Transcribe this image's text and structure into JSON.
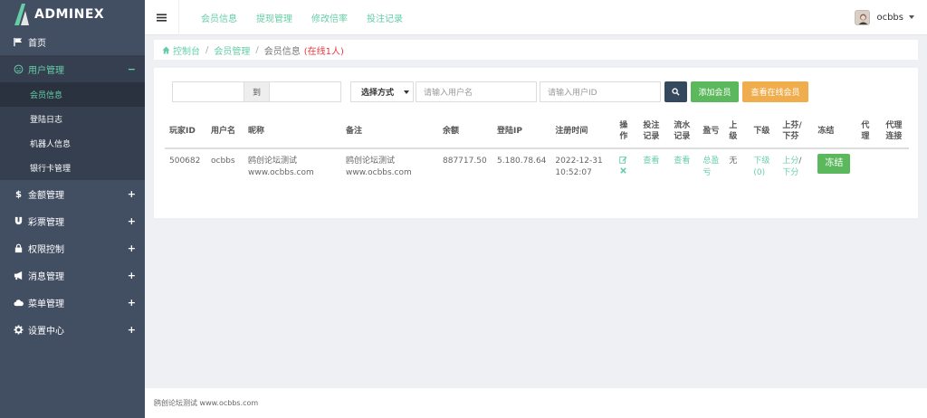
{
  "app": {
    "logo_text": "ADMINEX"
  },
  "colors": {
    "sidebar": "#424f63",
    "accent": "#65cea7",
    "success": "#5cb85c",
    "warning": "#f0ad4e",
    "primary_dark": "#34495e",
    "danger": "#e5383b"
  },
  "sidebar": {
    "items": [
      {
        "label": "首页",
        "icon": "flag-icon",
        "toggle": ""
      },
      {
        "label": "用户管理",
        "icon": "smile-icon",
        "toggle": "−",
        "active": true,
        "children": [
          "会员信息",
          "登陆日志",
          "机器人信息",
          "银行卡管理"
        ]
      },
      {
        "label": "金额管理",
        "icon": "dollar-icon",
        "toggle": "+"
      },
      {
        "label": "彩票管理",
        "icon": "magnet-icon",
        "toggle": "+"
      },
      {
        "label": "权限控制",
        "icon": "lock-icon",
        "toggle": "+"
      },
      {
        "label": "消息管理",
        "icon": "bullhorn-icon",
        "toggle": "+"
      },
      {
        "label": "菜单管理",
        "icon": "cloud-icon",
        "toggle": "+"
      },
      {
        "label": "设置中心",
        "icon": "gear-icon",
        "toggle": "+"
      }
    ]
  },
  "header": {
    "tabs": [
      "会员信息",
      "提现管理",
      "修改倍率",
      "投注记录"
    ],
    "username": "ocbbs"
  },
  "breadcrumb": {
    "home": "控制台",
    "section": "会员管理",
    "current": "会员信息",
    "online": "(在线1人)"
  },
  "filters": {
    "date_separator": "到",
    "select_value": "选择方式",
    "username_placeholder": "请输入用户名",
    "userid_placeholder": "请输入用户ID",
    "add_member": "添加会员",
    "view_online": "查看在线会员"
  },
  "table": {
    "headers": [
      "玩家ID",
      "用户名",
      "昵称",
      "备注",
      "余额",
      "登陆IP",
      "注册时间",
      "操作",
      "投注记录",
      "流水记录",
      "盈亏",
      "上级",
      "下级",
      "上芬/下芬",
      "冻结",
      "代理",
      "代理连接"
    ],
    "rows": [
      {
        "player_id": "500682",
        "username": "ocbbs",
        "nickname": "鸥创论坛测试www.ocbbs.com",
        "remark": "鸥创论坛测试www.ocbbs.com",
        "balance": "887717.50",
        "login_ip": "5.180.78.64",
        "reg_time": "2022-12-31 10:52:07",
        "bet_record": "查看",
        "flow_record": "查看",
        "profit": "总盈亏",
        "superior": "无",
        "subordinate": "下级(0)",
        "up_points": "上分",
        "slash": "/",
        "down_points": "下分",
        "freeze": "冻结"
      }
    ]
  },
  "footer": {
    "text": "鸥创论坛测试 www.ocbbs.com"
  }
}
